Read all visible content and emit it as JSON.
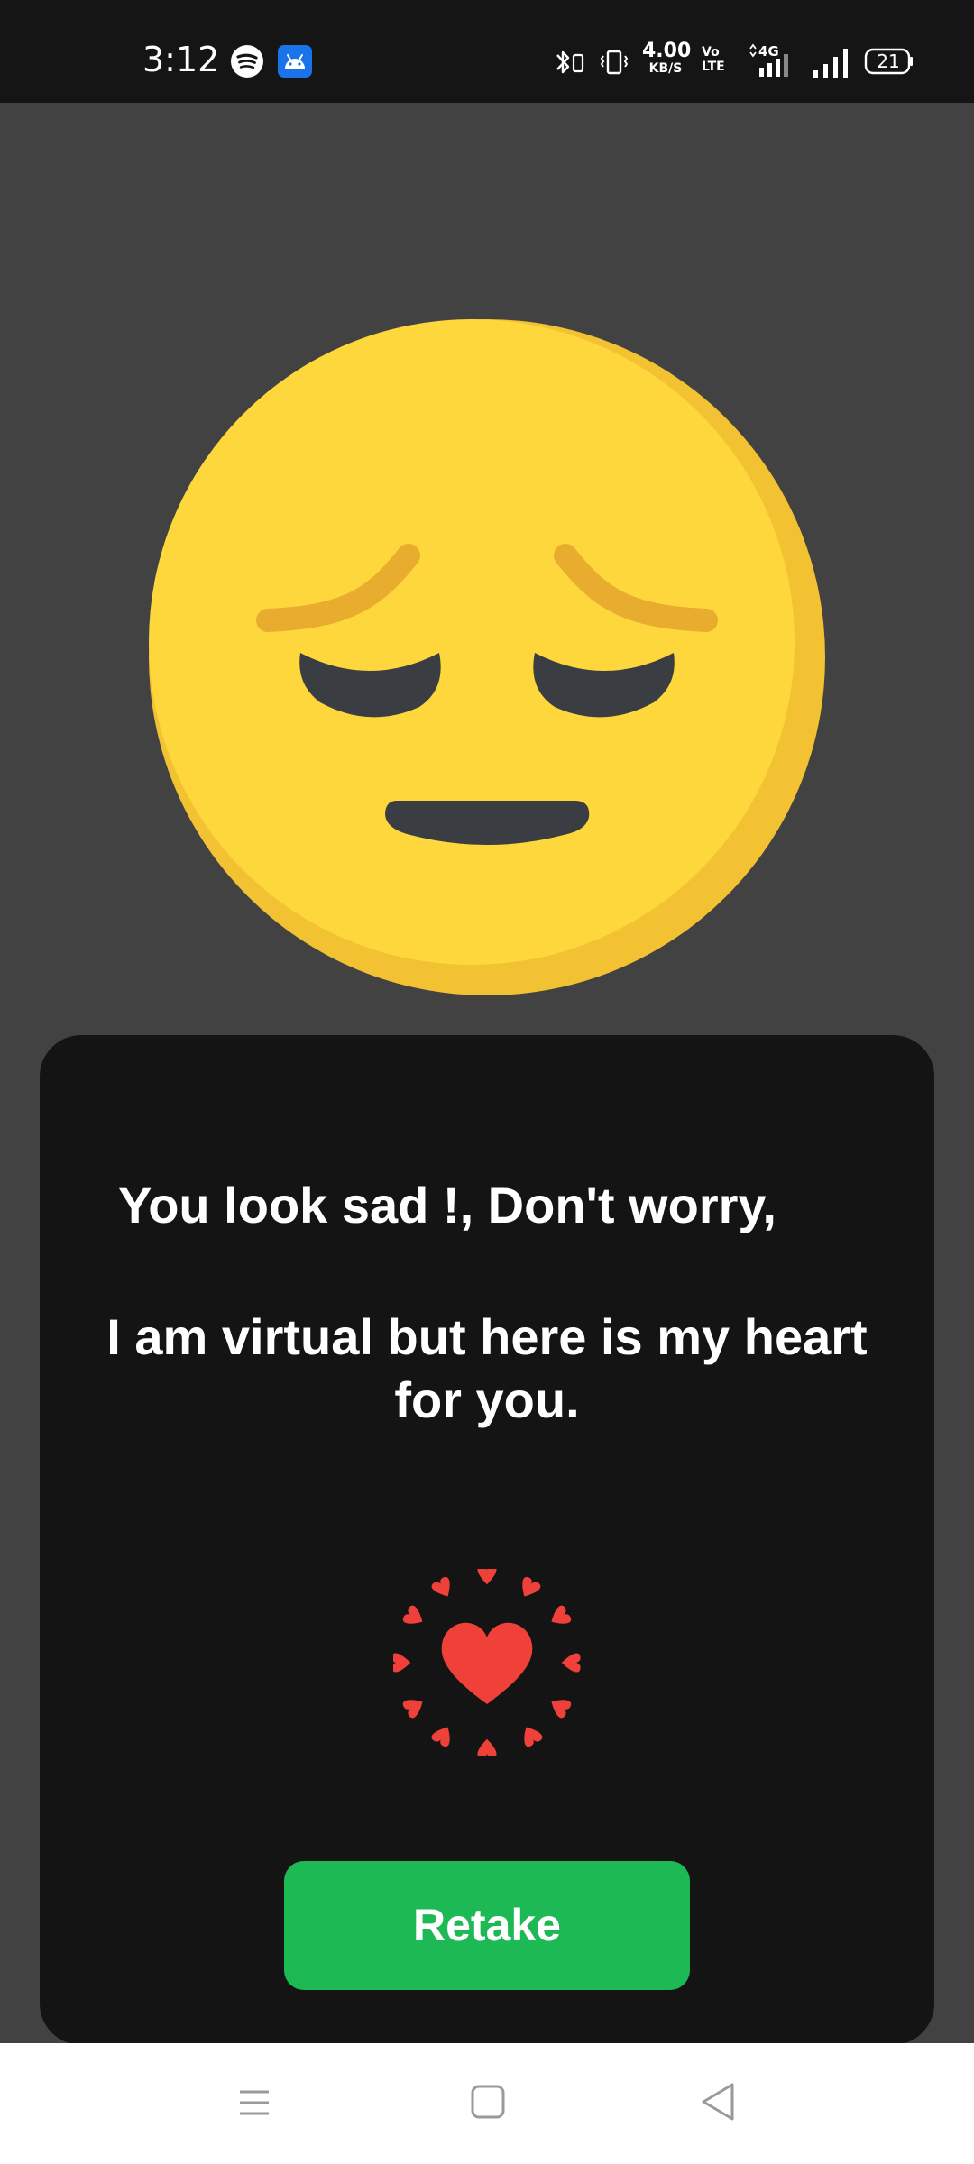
{
  "status_bar": {
    "time": "3:12",
    "net_speed_value": "4.00",
    "net_speed_unit": "KB/S",
    "volte_line1": "Vo",
    "volte_line2": "LTE",
    "network_type": "4G",
    "battery_level": "21",
    "icons": [
      "spotify-icon",
      "android-icon",
      "bluetooth-icon",
      "vibrate-icon",
      "network-4g-icon",
      "signal-icon",
      "battery-icon"
    ]
  },
  "emoji": {
    "name": "pensive-face-emoji",
    "face_color": "#FDD73C",
    "shade_color": "#F2C232",
    "feature_color": "#3A3D42",
    "brow_color": "#E8AD2E"
  },
  "card": {
    "message_line1": "You look sad !, Don't worry,",
    "message_line2": "I am virtual but here is my heart for you.",
    "heart_color": "#F0403A",
    "retake_label": "Retake",
    "retake_color": "#1DB954"
  },
  "nav_bar": {
    "icons": [
      "menu-icon",
      "home-icon",
      "back-icon"
    ]
  }
}
